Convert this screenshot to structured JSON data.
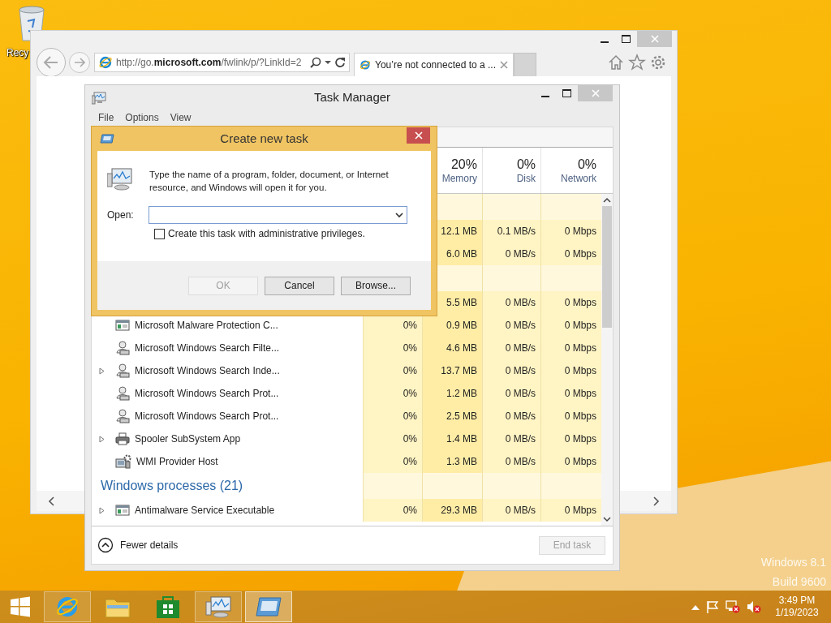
{
  "desktop": {
    "icons": [
      {
        "label": "Recy"
      }
    ],
    "watermark": [
      "Windows 8.1",
      "Build 9600"
    ]
  },
  "browser": {
    "address": "http://go.**microsoft.com**/fwlink/p/?LinkId=2",
    "tabs": [
      {
        "title": "You’re not connected to a ...",
        "selected": true
      }
    ]
  },
  "task_manager": {
    "title": "Task Manager",
    "menu": [
      "File",
      "Options",
      "View"
    ],
    "columns": [
      {
        "percent": "20%",
        "label": "Memory"
      },
      {
        "percent": "0%",
        "label": "Disk"
      },
      {
        "percent": "0%",
        "label": "Network"
      }
    ],
    "rows": [
      {
        "kind": "group"
      },
      {
        "kind": "process",
        "memory": "12.1 MB",
        "disk": "0.1 MB/s",
        "network": "0 Mbps"
      },
      {
        "kind": "process",
        "memory": "6.0 MB",
        "disk": "0 MB/s",
        "network": "0 Mbps"
      },
      {
        "kind": "group"
      },
      {
        "kind": "process",
        "memory": "5.5 MB",
        "disk": "0 MB/s",
        "network": "0 Mbps"
      },
      {
        "kind": "window",
        "expandable": false,
        "name": "Microsoft Malware Protection C...",
        "cpu": "0%",
        "memory": "0.9 MB",
        "disk": "0 MB/s",
        "network": "0 Mbps"
      },
      {
        "kind": "user",
        "expandable": false,
        "name": "Microsoft Windows Search Filte...",
        "cpu": "0%",
        "memory": "4.6 MB",
        "disk": "0 MB/s",
        "network": "0 Mbps"
      },
      {
        "kind": "user",
        "expandable": true,
        "name": "Microsoft Windows Search Inde...",
        "cpu": "0%",
        "memory": "13.7 MB",
        "disk": "0 MB/s",
        "network": "0 Mbps"
      },
      {
        "kind": "user",
        "expandable": false,
        "name": "Microsoft Windows Search Prot...",
        "cpu": "0%",
        "memory": "1.2 MB",
        "disk": "0 MB/s",
        "network": "0 Mbps"
      },
      {
        "kind": "user",
        "expandable": false,
        "name": "Microsoft Windows Search Prot...",
        "cpu": "0%",
        "memory": "2.5 MB",
        "disk": "0 MB/s",
        "network": "0 Mbps"
      },
      {
        "kind": "printer",
        "expandable": true,
        "name": "Spooler SubSystem App",
        "cpu": "0%",
        "memory": "1.4 MB",
        "disk": "0 MB/s",
        "network": "0 Mbps"
      },
      {
        "kind": "wmi",
        "expandable": false,
        "name": "WMI Provider Host",
        "cpu": "0%",
        "memory": "1.3 MB",
        "disk": "0 MB/s",
        "network": "0 Mbps"
      },
      {
        "kind": "group",
        "name": "Windows processes (21)"
      },
      {
        "kind": "window",
        "expandable": true,
        "name": "Antimalware Service Executable",
        "cpu": "0%",
        "memory": "29.3 MB",
        "disk": "0 MB/s",
        "network": "0 Mbps"
      }
    ],
    "footer": {
      "details": "Fewer details",
      "end_task": {
        "label": "End task",
        "disabled": true
      }
    }
  },
  "dialog": {
    "title": "Create new task",
    "message": "Type the name of a program, folder, document, or Internet resource, and Windows will open it for you.",
    "open_label": "Open:",
    "checkbox": {
      "label": "Create this task with administrative privileges.",
      "checked": false
    },
    "buttons": [
      {
        "label": "OK",
        "disabled": true
      },
      {
        "label": "Cancel",
        "disabled": false
      },
      {
        "label": "Browse...",
        "disabled": false
      }
    ]
  },
  "taskbar": {
    "apps": [
      {
        "kind": "ie",
        "open": true,
        "selected": false
      },
      {
        "kind": "explorer",
        "open": false,
        "selected": false
      },
      {
        "kind": "store",
        "open": false,
        "selected": false
      },
      {
        "kind": "taskmgr",
        "open": true,
        "selected": false
      },
      {
        "kind": "dialog",
        "open": true,
        "selected": true
      }
    ],
    "clock": {
      "time": "3:49 PM",
      "date": "1/19/2023"
    }
  }
}
